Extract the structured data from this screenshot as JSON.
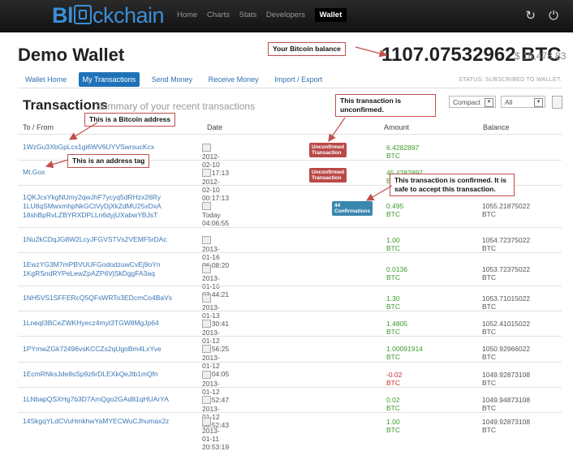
{
  "brand": {
    "logo_pre": "Bl",
    "logo_post": "ckchain"
  },
  "nav": {
    "items": [
      "Home",
      "Charts",
      "Stats",
      "Developers"
    ],
    "active": "Wallet"
  },
  "page": {
    "title": "Demo Wallet",
    "balance": "1107.07532962 BTC",
    "balance_usd": "$ 16,478.83",
    "status": "STATUS: SUBSCRIBED TO WALLET."
  },
  "tabs": [
    "Wallet Home",
    "My Transactions",
    "Send Money",
    "Receive Money",
    "Import / Export"
  ],
  "section": {
    "title": "Transactions",
    "subtitle": "Summary of your recent transactions"
  },
  "controls": {
    "view": "Compact",
    "filter": "All"
  },
  "columns": {
    "to_from": "To / From",
    "date": "Date",
    "amount": "Amount",
    "balance": "Balance"
  },
  "annotations": {
    "balance": "Your Bitcoin balance",
    "address": "This is a Bitcoin address",
    "tag": "This is an address tag",
    "unconfirmed": "This transaction is unconfirmed.",
    "confirmed": "This transaction is confirmed. It is safe to accept this transaction."
  },
  "rows": [
    {
      "addresses": [
        "1WzGu3XbGpLcs1gi6WV6UYVSwrsucKcx"
      ],
      "date": "2012-02-10 00:17:13",
      "badge": "Unconfirmed Transaction",
      "badge_color": "red",
      "amount": "6.4282897 BTC",
      "amount_sign": "pos",
      "balance": ""
    },
    {
      "addresses": [
        "Mt.Gox"
      ],
      "date": "2012-02-10 00:17:13",
      "badge": "Unconfirmed Transaction",
      "badge_color": "red",
      "amount": "45.4282897 BTC",
      "amount_sign": "pos",
      "balance": ""
    },
    {
      "addresses": [
        "1QKJcsYkgNUmy2qwJhF7ycyq5dRHzx26Ry",
        "1LU8qSMwxmhpNkGCtVyDjXkZdMU25xDxA",
        "18shBpRvLZBYRXDPLLn6dyjUXabwYBJsT"
      ],
      "date": "Today 04:06:55",
      "badge": "44 Confirmations",
      "badge_color": "blue",
      "amount": "0.495 BTC",
      "amount_sign": "pos",
      "balance": "1055.21875022 BTC"
    },
    {
      "addresses": [
        "1Nu2kCDqJG8W2LcyJFGVSTVs2VEMF5rDAc"
      ],
      "date": "2013-01-16 06:08:20",
      "badge": "",
      "badge_color": "",
      "amount": "1.00 BTC",
      "amount_sign": "pos",
      "balance": "1054.72375022 BTC"
    },
    {
      "addresses": [
        "1EwzYG3M7mPBVUUFGododzuwCvEj9oYn",
        "1KgRSndRYPeLewZpAZP6VjSkDggFA3aq"
      ],
      "date": "2013-01-16 03:44:21",
      "badge": "",
      "badge_color": "",
      "amount": "0.0136 BTC",
      "amount_sign": "pos",
      "balance": "1053.72375022 BTC"
    },
    {
      "addresses": [
        "1NH5VS1SFFERcQ5QFsWRTo3EDcmCo4BaVs"
      ],
      "date": "2013-01-13 06:30:41",
      "badge": "",
      "badge_color": "",
      "amount": "1.30 BTC",
      "amount_sign": "pos",
      "balance": "1053.71015022 BTC"
    },
    {
      "addresses": [
        "1LneqI3BCeZWKHyecz4myt3TGW8MgJp64"
      ],
      "date": "2013-01-12 06:56:25",
      "badge": "",
      "badge_color": "",
      "amount": "1.4805 BTC",
      "amount_sign": "pos",
      "balance": "1052.41015022 BTC"
    },
    {
      "addresses": [
        "1PYmwZGk72496vsKCCZs2qUgoBm4LxYve"
      ],
      "date": "2013-01-12 05:04:05",
      "badge": "",
      "badge_color": "",
      "amount": "1.00091914 BTC",
      "amount_sign": "pos",
      "balance": "1050.92966022 BTC"
    },
    {
      "addresses": [
        "1EcmRNksJde8sSp9z6rDLEXkQeJtb1mQfn"
      ],
      "date": "2013-01-12 03:52:47",
      "badge": "",
      "badge_color": "",
      "amount": "-0.02 BTC",
      "amount_sign": "neg",
      "balance": "1049.92873108 BTC"
    },
    {
      "addresses": [
        "1LNbapQSXHg7b3D7AmQgo2GAd81qHUArYA"
      ],
      "date": "2013-01-12 03:52:43",
      "badge": "",
      "badge_color": "",
      "amount": "0.02 BTC",
      "amount_sign": "pos",
      "balance": "1049.94873108 BTC"
    },
    {
      "addresses": [
        "14SkgqYLdCVuHmkhwYaMYECWuCJhumax2z"
      ],
      "date": "2013-01-11 20:53:19",
      "badge": "",
      "badge_color": "",
      "amount": "1.00 BTC",
      "amount_sign": "pos",
      "balance": "1049.92873108 BTC"
    }
  ]
}
